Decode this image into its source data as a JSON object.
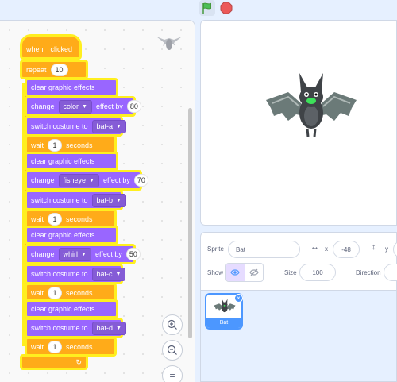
{
  "toolbar": {
    "green_flag_icon": "green-flag-icon",
    "stop_icon": "stop-icon"
  },
  "script": {
    "hat_when": "when",
    "hat_clicked": "clicked",
    "repeat_label": "repeat",
    "repeat_count": "10",
    "clear_effects": "clear graphic effects",
    "change_label": "change",
    "effect_by": "effect by",
    "switch_costume": "switch costume to",
    "wait_label": "wait",
    "seconds": "seconds",
    "wait_value": "1",
    "effect1": "color",
    "effect1_value": "80",
    "effect2": "fisheye",
    "effect2_value": "70",
    "effect3": "whirl",
    "effect3_value": "50",
    "costume_a": "bat-a",
    "costume_b": "bat-b",
    "costume_c": "bat-c",
    "costume_d": "bat-d"
  },
  "zoom": {
    "zoom_in": "+",
    "zoom_out": "−",
    "reset": "="
  },
  "sprite_info": {
    "sprite_label": "Sprite",
    "sprite_name": "Bat",
    "x_label": "x",
    "x_value": "-48",
    "y_label": "y",
    "show_label": "Show",
    "size_label": "Size",
    "size_value": "100",
    "direction_label": "Direction"
  },
  "sprite_list": {
    "items": [
      {
        "name": "Bat"
      }
    ]
  },
  "colors": {
    "events": "#ffab19",
    "looks": "#9966ff",
    "highlight": "#ffef1f",
    "accent": "#4c97ff"
  }
}
